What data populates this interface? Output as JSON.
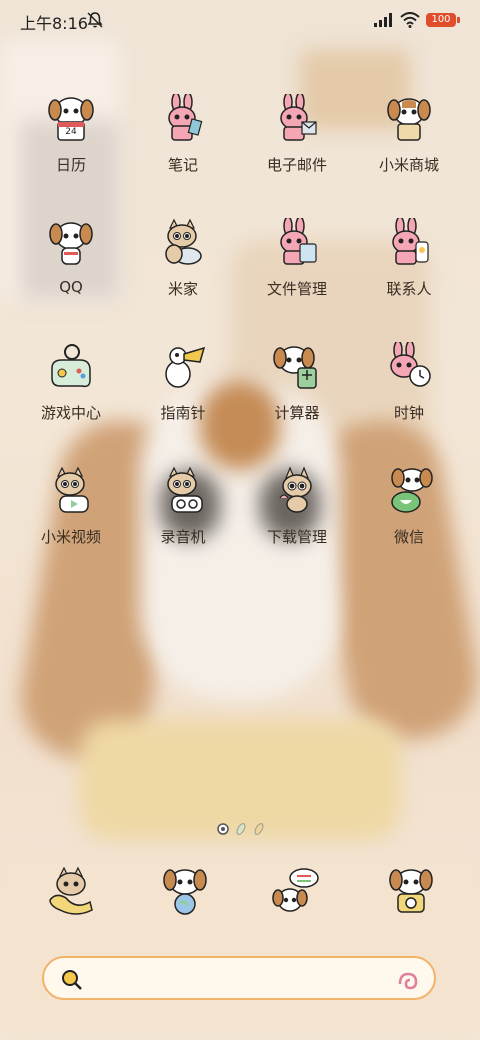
{
  "status_bar": {
    "time": "上午8:16",
    "battery": "100"
  },
  "apps": [
    {
      "label": "日历",
      "icon": "dog-calendar-icon",
      "date": "24"
    },
    {
      "label": "笔记",
      "icon": "rabbit-notes-icon"
    },
    {
      "label": "电子邮件",
      "icon": "rabbit-mail-icon"
    },
    {
      "label": "小米商城",
      "icon": "dog-shop-icon"
    },
    {
      "label": "QQ",
      "icon": "dog-qq-icon"
    },
    {
      "label": "米家",
      "icon": "cat-home-icon"
    },
    {
      "label": "文件管理",
      "icon": "rabbit-files-icon"
    },
    {
      "label": "联系人",
      "icon": "rabbit-contacts-icon"
    },
    {
      "label": "游戏中心",
      "icon": "gamepad-icon"
    },
    {
      "label": "指南针",
      "icon": "pelican-compass-icon"
    },
    {
      "label": "计算器",
      "icon": "dog-calculator-icon"
    },
    {
      "label": "时钟",
      "icon": "rabbit-clock-icon"
    },
    {
      "label": "小米视频",
      "icon": "cat-video-icon"
    },
    {
      "label": "录音机",
      "icon": "cat-recorder-icon"
    },
    {
      "label": "下载管理",
      "icon": "cat-download-icon"
    },
    {
      "label": "微信",
      "icon": "dog-wechat-icon"
    }
  ],
  "page_indicator": {
    "pages": 3,
    "current": 1
  },
  "dock": [
    {
      "icon": "cat-phone-icon"
    },
    {
      "icon": "dog-browser-icon"
    },
    {
      "icon": "dog-messages-icon"
    },
    {
      "icon": "dog-camera-icon"
    }
  ],
  "search": {
    "placeholder": ""
  },
  "colors": {
    "dog_brown": "#c98a50",
    "rabbit_pink": "#f4a6b4",
    "cat_beige": "#e6cba8",
    "accent_orange": "#f2b26a",
    "battery_red": "#e04d2a"
  }
}
